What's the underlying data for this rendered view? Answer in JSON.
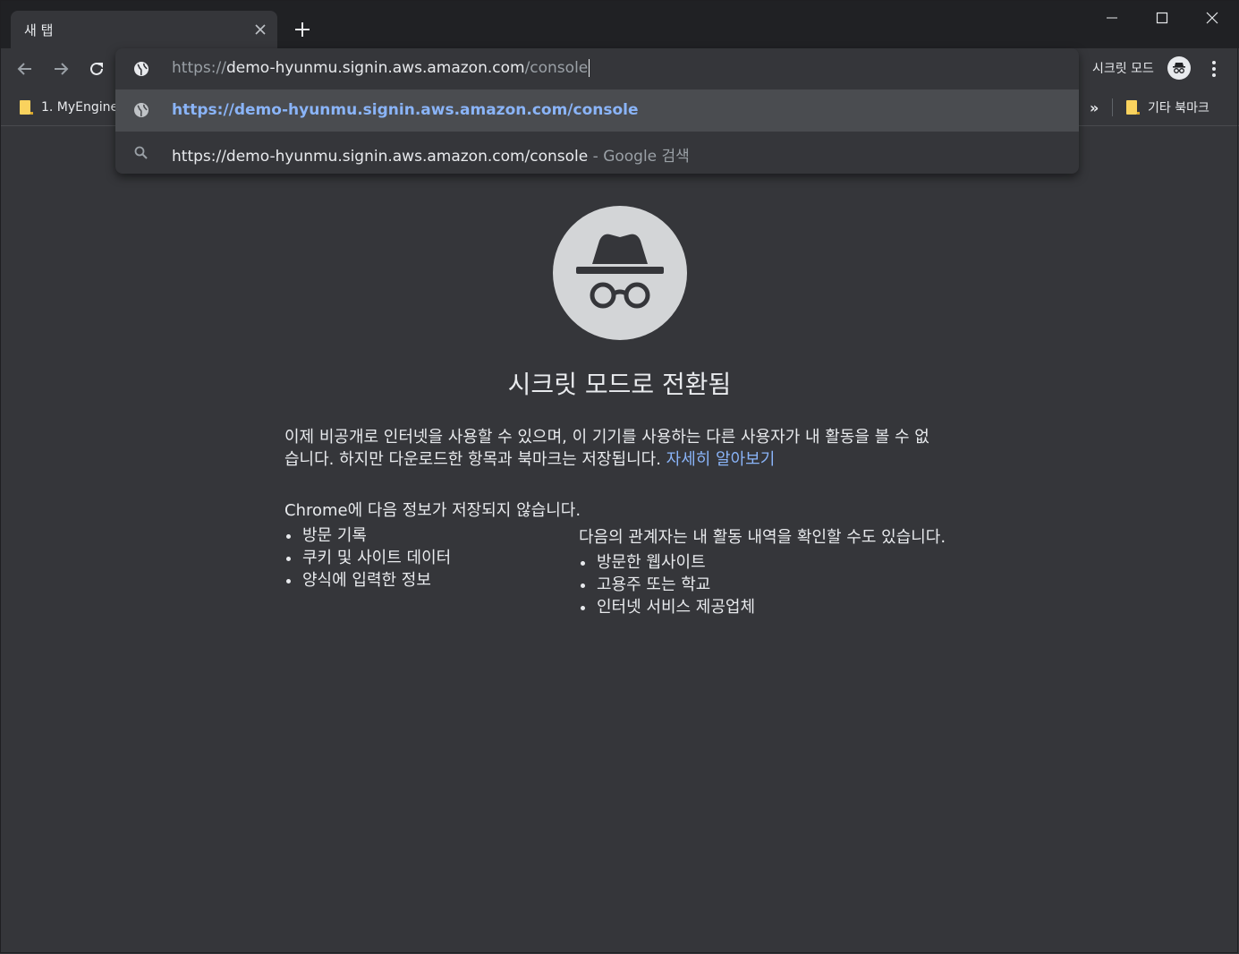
{
  "tab": {
    "title": "새 탭"
  },
  "toolbar": {
    "incognito_label": "시크릿 모드"
  },
  "bookmarks": {
    "first": "1. MyEngine",
    "overflow": "»",
    "other": "기타 북마크"
  },
  "omnibox": {
    "typed_prefix": "https://",
    "typed_host": "demo-hyunmu.signin.aws.amazon.com",
    "typed_path": "/console",
    "suggestion_url": "https://demo-hyunmu.signin.aws.amazon.com/console",
    "search_query": "https://demo-hyunmu.signin.aws.amazon.com/console",
    "search_suffix": " - Google 검색"
  },
  "content": {
    "heading": "시크릿 모드로 전환됨",
    "paragraph_line1": "이제 비공개로 인터넷을 사용할 수 있으며, 이 기기를 사용하는 다른 사용자가 내 활동을 볼 수 없",
    "paragraph_line2": "습니다. 하지만 다운로드한 항목과 북마크는 저장됩니다. ",
    "learn_more": "자세히 알아보기",
    "not_saved_heading": "Chrome에 다음 정보가 저장되지 않습니다.",
    "not_saved_items": [
      "방문 기록",
      "쿠키 및 사이트 데이터",
      "양식에 입력한 정보"
    ],
    "visible_heading": "다음의 관계자는 내 활동 내역을 확인할 수도 있습니다.",
    "visible_items": [
      "방문한 웹사이트",
      "고용주 또는 학교",
      "인터넷 서비스 제공업체"
    ]
  },
  "colors": {
    "background": "#35363a",
    "tabstrip": "#202124",
    "link": "#8ab4f8",
    "hero": "#d3d5d7"
  },
  "icons": [
    "back-icon",
    "forward-icon",
    "reload-icon",
    "globe-icon",
    "search-icon",
    "incognito-icon",
    "menu-icon",
    "folder-icon",
    "close-icon",
    "plus-icon",
    "minimize-icon",
    "maximize-icon"
  ]
}
